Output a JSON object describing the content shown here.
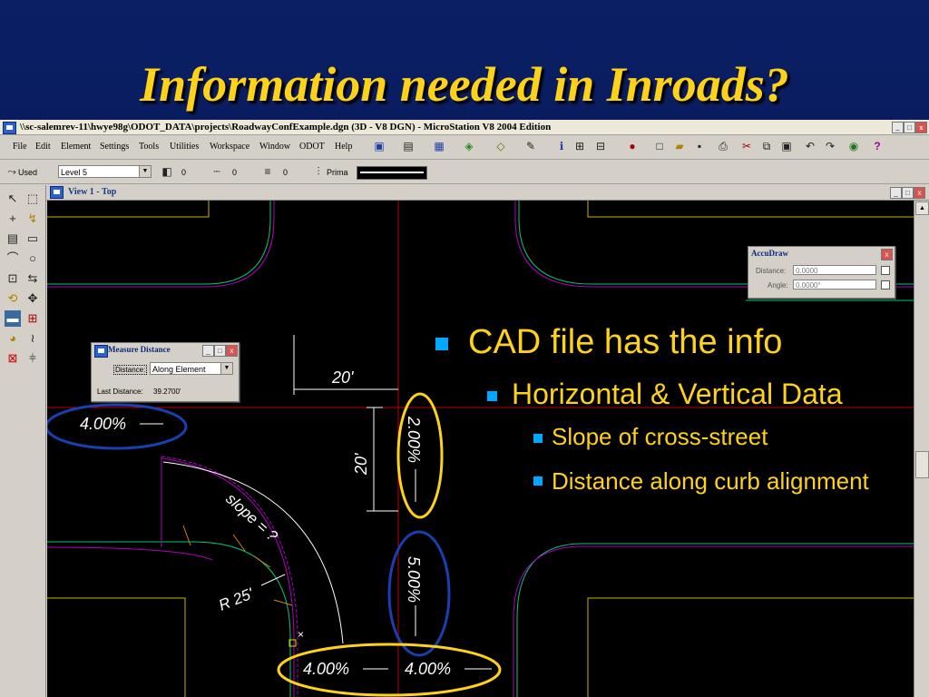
{
  "slide": {
    "title": "Information needed in Inroads?",
    "bullets": {
      "level1": "CAD file has the info",
      "level2": "Horizontal & Vertical Data",
      "level3a": "Slope of cross-street",
      "level3b": "Distance along curb alignment"
    }
  },
  "window": {
    "title": "\\\\sc-salemrev-11\\hwye98g\\ODOT_DATA\\projects\\RoadwayConfExample.dgn (3D - V8 DGN) - MicroStation V8 2004 Edition",
    "menus": [
      "File",
      "Edit",
      "Element",
      "Settings",
      "Tools",
      "Utilities",
      "Workspace",
      "Window",
      "ODOT",
      "Help"
    ]
  },
  "attributes": {
    "used_label": "Used",
    "level": "Level 5",
    "color_value": "0",
    "style_value": "0",
    "weight_value": "0",
    "class_label": "Prima"
  },
  "view": {
    "title": "View 1 - Top"
  },
  "accudraw": {
    "title": "AccuDraw",
    "distance_label": "Distance:",
    "distance_value": "0.0000",
    "angle_label": "Angle:",
    "angle_value": "0.0000°"
  },
  "measure": {
    "title": "Measure Distance",
    "distance_label": "Distance:",
    "method": "Along Element",
    "last_label": "Last Distance:",
    "last_value": "39.2700'"
  },
  "drawing": {
    "dim_h": "20'",
    "dim_v": "20'",
    "slope_left": "4.00%",
    "slope_top": "2.00%",
    "slope_mid": "5.00%",
    "slope_bottom_left": "4.00%",
    "slope_bottom_right": "4.00%",
    "slope_label": "slope = ?",
    "radius": "R 25'"
  },
  "colors": {
    "title": "#ffd21a",
    "bullet": "#00a8ff",
    "ellipse_blue": "#1a3fb0",
    "ellipse_yellow": "#ffd21a",
    "cad_green": "#00c878",
    "cad_magenta": "#b000c0",
    "cad_red": "#c00000"
  }
}
